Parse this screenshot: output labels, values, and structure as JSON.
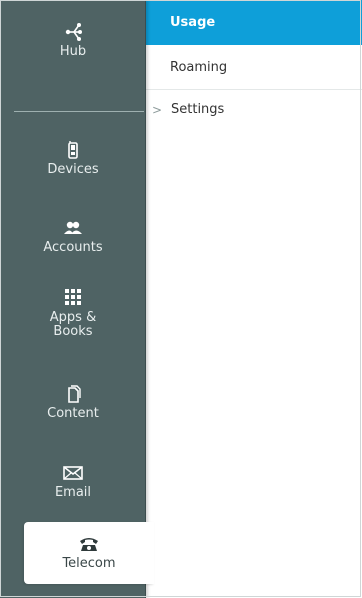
{
  "nav": {
    "hub": {
      "label": "Hub",
      "icon": "hub-icon"
    },
    "devices": {
      "label": "Devices",
      "icon": "phone-icon"
    },
    "accounts": {
      "label": "Accounts",
      "icon": "users-icon"
    },
    "apps_books": {
      "label": "Apps &\nBooks",
      "icon": "grid-icon"
    },
    "content": {
      "label": "Content",
      "icon": "document-icon"
    },
    "email": {
      "label": "Email",
      "icon": "envelope-icon"
    },
    "telecom": {
      "label": "Telecom",
      "icon": "telephone-icon"
    }
  },
  "submenu": {
    "usage": "Usage",
    "roaming": "Roaming",
    "settings": "Settings",
    "settings_chevron": ">"
  },
  "colors": {
    "rail": "#4f6364",
    "accent": "#0e9fd9"
  }
}
